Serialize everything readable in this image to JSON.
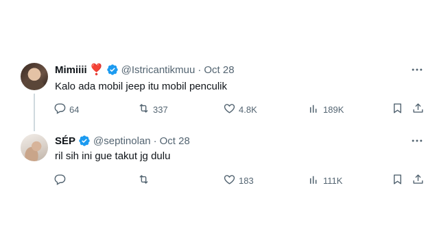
{
  "tweets": [
    {
      "name": "Mimiiii",
      "emoji": "❣️",
      "handle": "@Istricantikmuu",
      "separator": "·",
      "date": "Oct 28",
      "text": "Kalo ada mobil jeep itu mobil penculik",
      "replies": "64",
      "retweets": "337",
      "likes": "4.8K",
      "views": "189K"
    },
    {
      "name": "SÉP",
      "handle": "@septinolan",
      "separator": "·",
      "date": "Oct 28",
      "text": "ril sih ini gue takut jg dulu",
      "replies": "",
      "retweets": "",
      "likes": "183",
      "views": "111K"
    }
  ],
  "icons": {
    "verified": "verified-badge-icon",
    "more": "more-dots-icon",
    "reply": "reply-bubble-icon",
    "retweet": "retweet-icon",
    "like": "heart-icon",
    "views": "views-bars-icon",
    "bookmark": "bookmark-icon",
    "share": "share-icon"
  },
  "colors": {
    "verified": "#1d9bf0",
    "secondary_text": "#536471",
    "heart_emoji": "#e0245e",
    "thread_line": "#cfd9de"
  }
}
